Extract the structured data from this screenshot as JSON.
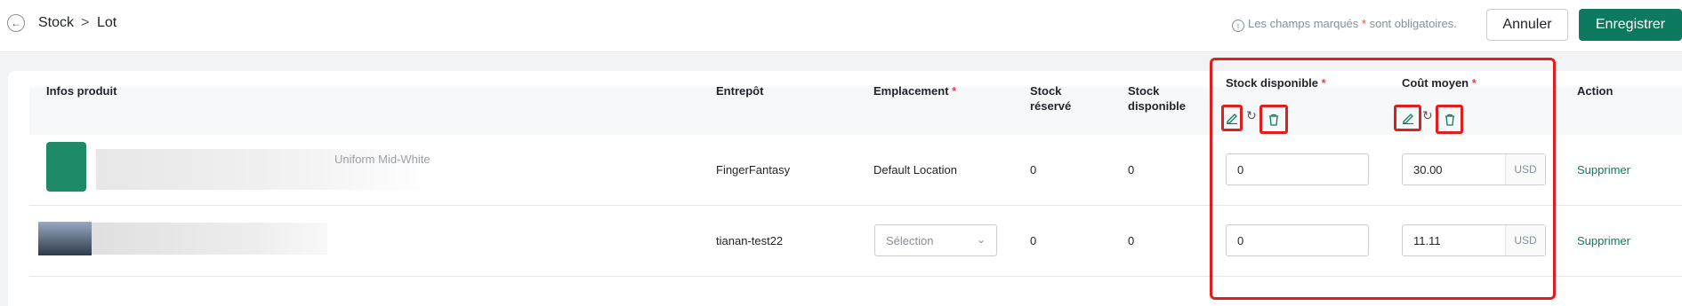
{
  "breadcrumb": {
    "root": "Stock",
    "separator": ">",
    "current": "Lot"
  },
  "header": {
    "hint_prefix": "Les champs marqués",
    "hint_star": "*",
    "hint_suffix": "sont obligatoires.",
    "cancel_label": "Annuler",
    "save_label": "Enregistrer"
  },
  "table": {
    "columns": {
      "product": "Infos produit",
      "warehouse": "Entrepôt",
      "location": "Emplacement",
      "reserved_line1": "Stock",
      "reserved_line2": "réservé",
      "available_line1": "Stock",
      "available_line2": "disponible",
      "available_edit": "Stock disponible",
      "avg_cost": "Coût moyen",
      "action": "Action",
      "required_mark": "*"
    },
    "rows": [
      {
        "product_name": "Uniform Mid-White",
        "warehouse": "FingerFantasy",
        "location": "Default Location",
        "reserved": "0",
        "available": "0",
        "available_input": "0",
        "cost_input": "30.00",
        "currency": "USD",
        "action": "Supprimer"
      },
      {
        "product_name": "",
        "warehouse": "tianan-test22",
        "location_placeholder": "Sélection",
        "reserved": "0",
        "available": "0",
        "available_input": "0",
        "cost_input": "11.11",
        "currency": "USD",
        "action": "Supprimer"
      }
    ]
  },
  "colors": {
    "accent": "#0d7a5f",
    "required": "#f53f3f",
    "annotation": "#e01e1e"
  },
  "icons": [
    "arrow-left-icon",
    "info-icon",
    "edit-icon",
    "reset-icon",
    "trash-icon",
    "chevron-down-icon"
  ]
}
